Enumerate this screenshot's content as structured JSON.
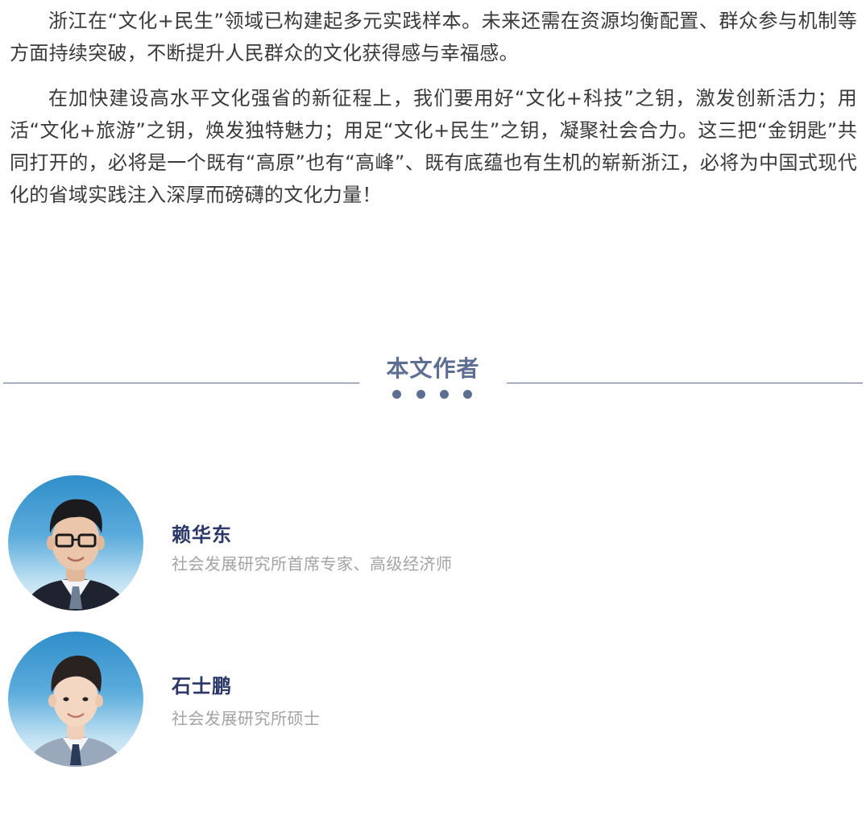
{
  "article": {
    "paragraphs": [
      "浙江在“文化+民生”领域已构建起多元实践样本。未来还需在资源均衡配置、群众参与机制等方面持续突破，不断提升人民群众的文化获得感与幸福感。",
      "在加快建设高水平文化强省的新征程上，我们要用好“文化+科技”之钥，激发创新活力；用活“文化+旅游”之钥，焕发独特魅力；用足“文化+民生”之钥，凝聚社会合力。这三把“金钥匙”共同打开的，必将是一个既有“高原”也有“高峰”、既有底蕴也有生机的崭新浙江，必将为中国式现代化的省域实践注入深厚而磅礴的文化力量！"
    ]
  },
  "section": {
    "title": "本文作者"
  },
  "authors": [
    {
      "name": "赖华东",
      "title": "社会发展研究所首席专家、高级经济师"
    },
    {
      "name": "石士鹏",
      "title": "社会发展研究所硕士"
    }
  ],
  "colors": {
    "accent": "#5e6e93",
    "name": "#2b3766",
    "muted": "#a3a3a3",
    "body_text": "#3a3a3a"
  },
  "icons": {
    "avatar_1": "person-portrait",
    "avatar_2": "person-portrait"
  }
}
